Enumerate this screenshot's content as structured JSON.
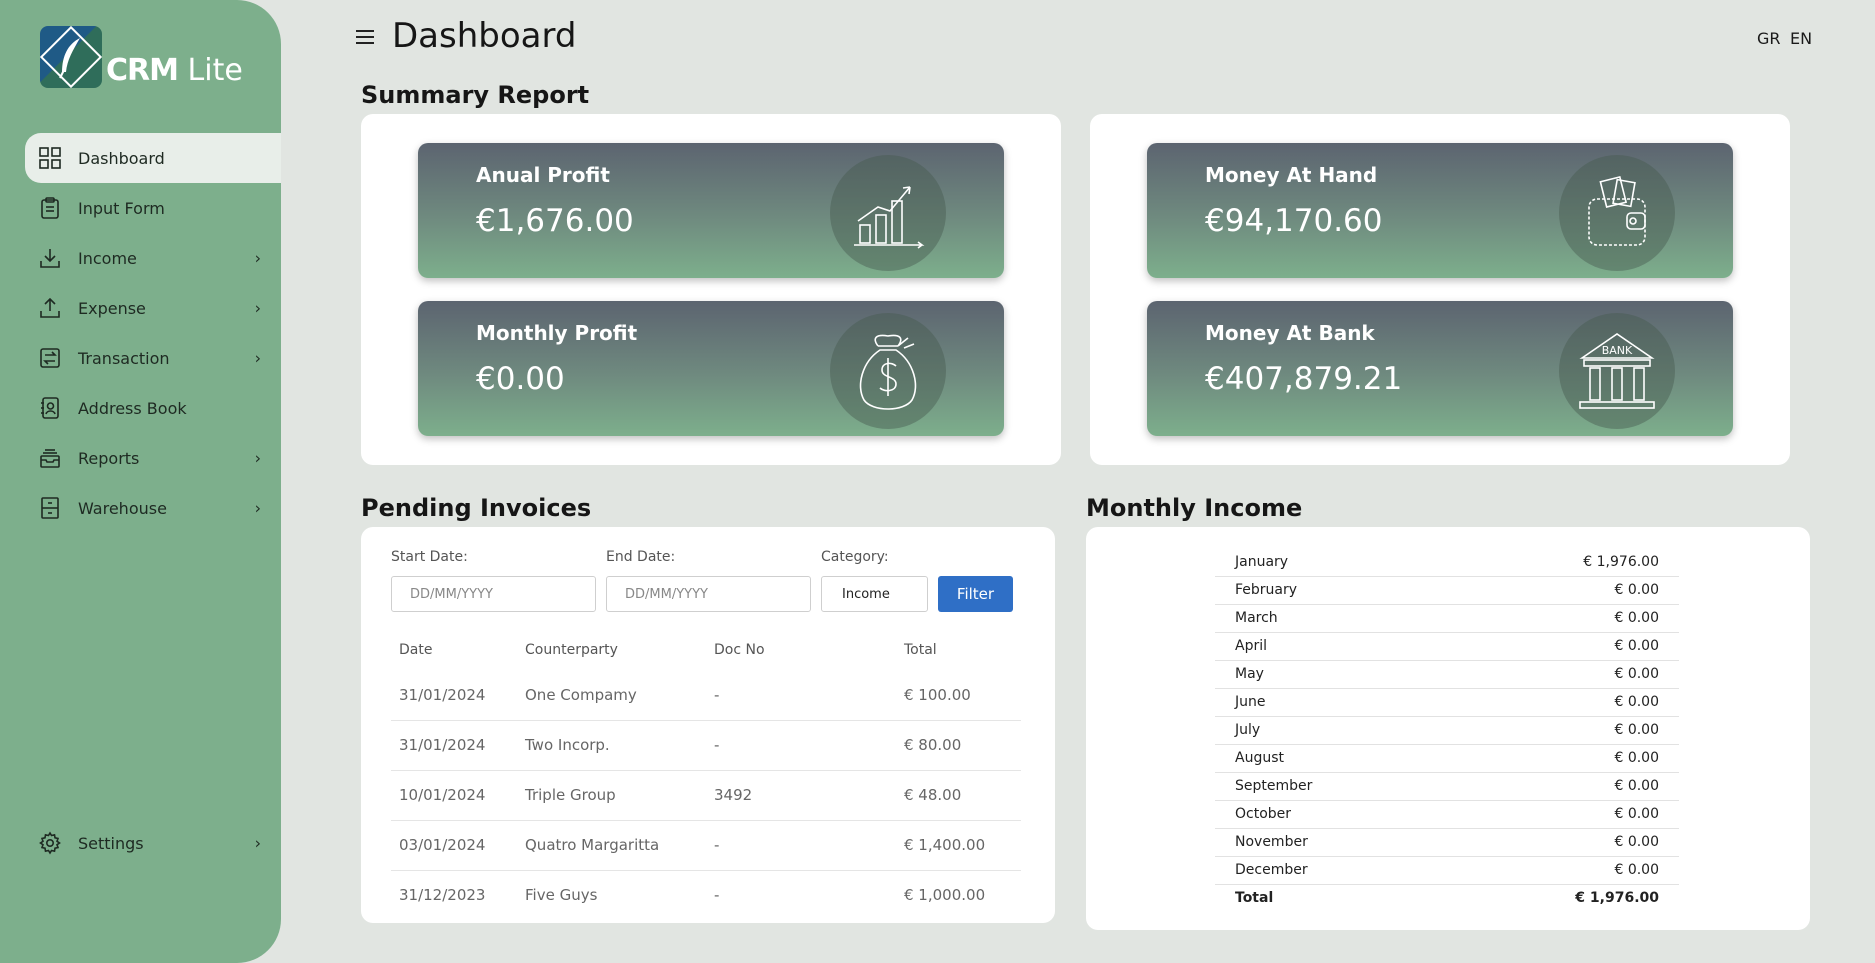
{
  "app": {
    "logo_bold": "CRM",
    "logo_light": " Lite"
  },
  "sidebar": {
    "items": [
      {
        "label": "Dashboard",
        "icon": "dashboard-icon",
        "active": true
      },
      {
        "label": "Input Form",
        "icon": "clipboard-icon"
      },
      {
        "label": "Income",
        "icon": "download-icon",
        "chevron": "›"
      },
      {
        "label": "Expense",
        "icon": "upload-icon",
        "chevron": "›"
      },
      {
        "label": "Transaction",
        "icon": "exchange-icon",
        "chevron": "›"
      },
      {
        "label": "Address Book",
        "icon": "address-book-icon"
      },
      {
        "label": "Reports",
        "icon": "inbox-icon",
        "chevron": "›"
      },
      {
        "label": "Warehouse",
        "icon": "cabinet-icon",
        "chevron": "›"
      }
    ],
    "settings": {
      "label": "Settings",
      "icon": "gear-icon",
      "chevron": "›"
    }
  },
  "header": {
    "title": "Dashboard",
    "lang_gr": "GR",
    "lang_en": "EN"
  },
  "summary": {
    "title": "Summary Report",
    "cards": [
      {
        "label": "Anual Profit",
        "value": "€1,676.00",
        "icon": "bar-growth-icon"
      },
      {
        "label": "Monthly Profit",
        "value": "€0.00",
        "icon": "money-bag-icon"
      },
      {
        "label": "Money At Hand",
        "value": "€94,170.60",
        "icon": "wallet-icon"
      },
      {
        "label": "Money At Bank",
        "value": "€407,879.21",
        "icon": "bank-icon",
        "icon_text": "BANK"
      }
    ]
  },
  "pending": {
    "title": "Pending Invoices",
    "filters": {
      "start_label": "Start Date:",
      "start_placeholder": "DD/MM/YYYY",
      "end_label": "End Date:",
      "end_placeholder": "DD/MM/YYYY",
      "category_label": "Category:",
      "category_value": "Income",
      "filter_button": "Filter"
    },
    "columns": [
      "Date",
      "Counterparty",
      "Doc No",
      "Total"
    ],
    "rows": [
      [
        "31/01/2024",
        "One Compamy",
        "-",
        "€ 100.00"
      ],
      [
        "31/01/2024",
        "Two Incorp.",
        "-",
        "€ 80.00"
      ],
      [
        "10/01/2024",
        "Triple Group",
        "3492",
        "€ 48.00"
      ],
      [
        "03/01/2024",
        "Quatro Margaritta",
        "-",
        "€ 1,400.00"
      ],
      [
        "31/12/2023",
        "Five Guys",
        "-",
        "€ 1,000.00"
      ]
    ]
  },
  "monthly_income": {
    "title": "Monthly Income",
    "rows": [
      [
        "January",
        "€ 1,976.00"
      ],
      [
        "February",
        "€ 0.00"
      ],
      [
        "March",
        "€ 0.00"
      ],
      [
        "April",
        "€ 0.00"
      ],
      [
        "May",
        "€ 0.00"
      ],
      [
        "June",
        "€ 0.00"
      ],
      [
        "July",
        "€ 0.00"
      ],
      [
        "August",
        "€ 0.00"
      ],
      [
        "September",
        "€ 0.00"
      ],
      [
        "October",
        "€ 0.00"
      ],
      [
        "November",
        "€ 0.00"
      ],
      [
        "December",
        "€ 0.00"
      ]
    ],
    "total": [
      "Total",
      "€ 1,976.00"
    ]
  }
}
